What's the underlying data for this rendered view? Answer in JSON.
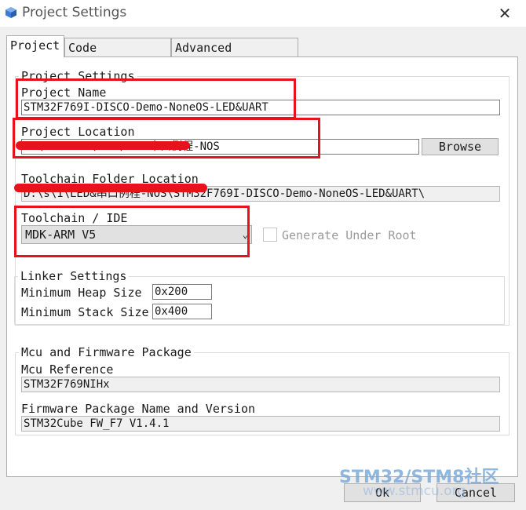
{
  "window": {
    "title": "Project Settings",
    "close_glyph": "✕"
  },
  "tabs": [
    {
      "label": "Project",
      "active": true
    },
    {
      "label": "Code Generator",
      "active": false
    },
    {
      "label": "Advanced Settings",
      "active": false
    }
  ],
  "project_settings": {
    "group_label": "Project Settings",
    "project_name_label": "Project Name",
    "project_name_value": "STM32F769I-DISCO-Demo-NoneOS-LED&UART",
    "project_location_label": "Project Location",
    "project_location_value": "C:\\STM32F7\\ST  \\LED&串口例程-NOS",
    "browse_label": "Browse",
    "toolchain_folder_label": "Toolchain Folder Location",
    "toolchain_folder_value": "D:\\s\\1\\LED&串口例程-NOS\\STM32F769I-DISCO-Demo-NoneOS-LED&UART\\",
    "toolchain_ide_label": "Toolchain / IDE",
    "toolchain_ide_value": "MDK-ARM V5",
    "generate_under_root_label": "Generate Under Root",
    "generate_under_root_checked": false
  },
  "linker_settings": {
    "group_label": "Linker Settings",
    "min_heap_label": "Minimum Heap Size",
    "min_heap_value": "0x200",
    "min_stack_label": "Minimum Stack Size",
    "min_stack_value": "0x400"
  },
  "mcu_firmware": {
    "group_label": "Mcu and Firmware Package",
    "mcu_reference_label": "Mcu Reference",
    "mcu_reference_value": "STM32F769NIHx",
    "firmware_label": "Firmware Package Name and Version",
    "firmware_value": "STM32Cube FW_F7 V1.4.1"
  },
  "buttons": {
    "ok_label": "Ok",
    "cancel_label": "Cancel"
  },
  "watermark": {
    "text": "STM32/STM8社区",
    "sub": "www.stmcu.org"
  },
  "colors": {
    "annotation_red": "#e8121c",
    "title_icon_blue": "#3a7bd5"
  }
}
